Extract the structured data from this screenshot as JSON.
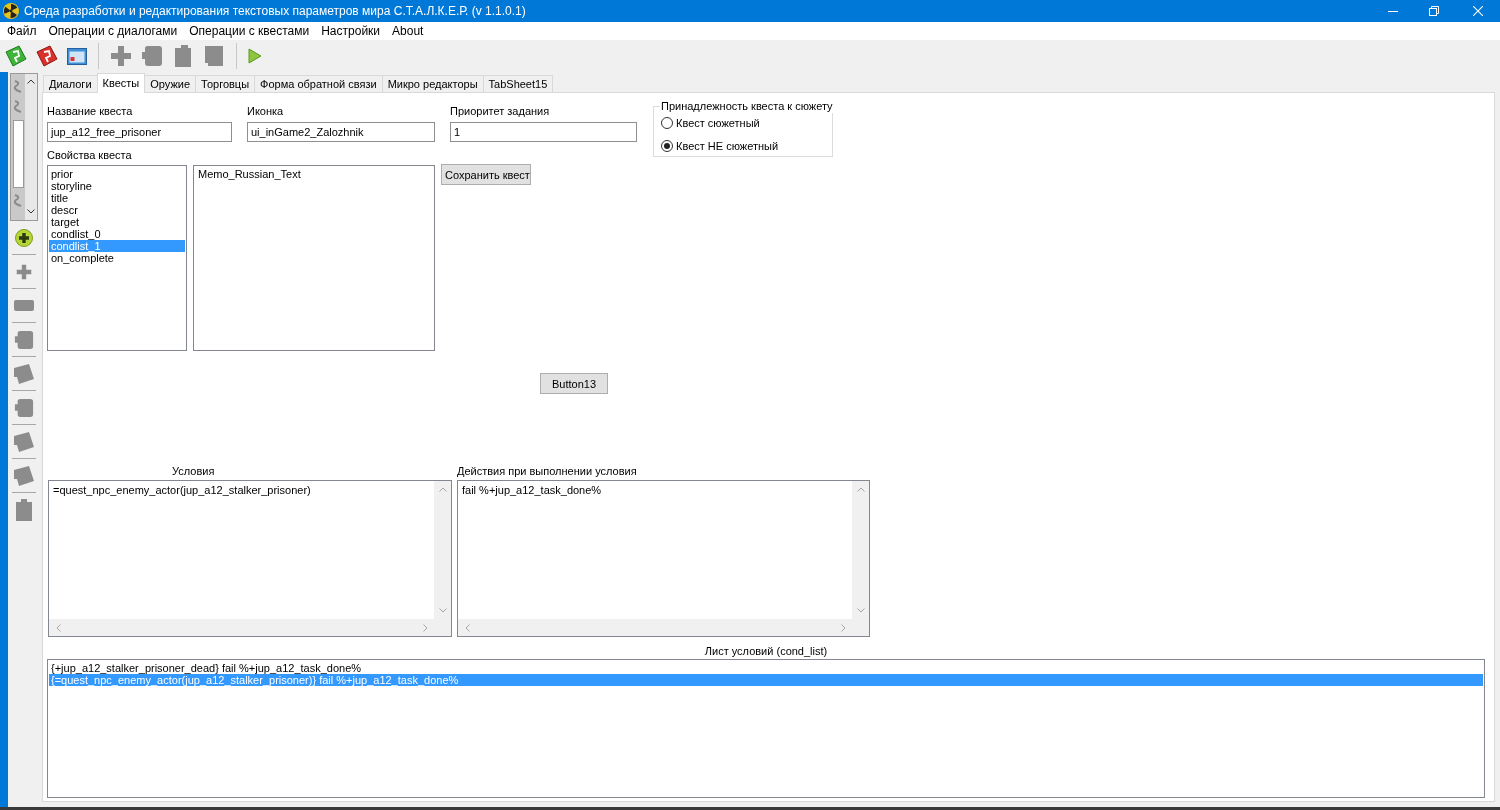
{
  "window": {
    "title": "Среда разработки и редактирования текстовых параметров мира С.Т.А.Л.К.Е.Р. (v 1.1.0.1)"
  },
  "menu": [
    {
      "label": "Файл"
    },
    {
      "label": "Операции с диалогами"
    },
    {
      "label": "Операции с квестами"
    },
    {
      "label": "Настройки"
    },
    {
      "label": "About"
    }
  ],
  "tabs": [
    {
      "label": "Диалоги",
      "selected": false
    },
    {
      "label": "Квесты",
      "selected": true
    },
    {
      "label": "Оружие",
      "selected": false
    },
    {
      "label": "Торговцы",
      "selected": false
    },
    {
      "label": "Форма обратной связи",
      "selected": false
    },
    {
      "label": "Микро редакторы",
      "selected": false
    },
    {
      "label": "TabSheet15",
      "selected": false
    }
  ],
  "quest_form": {
    "name_field": {
      "label": "Название квеста",
      "value": "jup_a12_free_prisoner"
    },
    "icon_field": {
      "label": "Иконка",
      "value": "ui_inGame2_Zalozhnik"
    },
    "priority_field": {
      "label": "Приоритет задания",
      "value": "1"
    },
    "storyline_group": {
      "title": "Принадлежность квеста к сюжету",
      "options": [
        {
          "label": "Квест сюжетный",
          "selected": false
        },
        {
          "label": "Квест НЕ сюжетный",
          "selected": true
        }
      ]
    },
    "properties": {
      "label": "Свойства квеста",
      "items": [
        {
          "label": "prior",
          "selected": false
        },
        {
          "label": "storyline",
          "selected": false
        },
        {
          "label": "title",
          "selected": false
        },
        {
          "label": "descr",
          "selected": false
        },
        {
          "label": "target",
          "selected": false
        },
        {
          "label": "condlist_0",
          "selected": false
        },
        {
          "label": "condlist_1",
          "selected": true
        },
        {
          "label": "on_complete",
          "selected": false
        }
      ]
    },
    "memo": {
      "value": "Memo_Russian_Text"
    },
    "save_button": {
      "label": "Сохранить квест"
    },
    "extra_button": {
      "label": "Button13"
    },
    "conditions": {
      "label": "Условия",
      "value": "=quest_npc_enemy_actor(jup_a12_stalker_prisoner)"
    },
    "actions": {
      "label": "Действия при выполнении условия",
      "value": "fail %+jup_a12_task_done%"
    },
    "cond_list": {
      "label": "Лист условий (cond_list)",
      "items": [
        {
          "label": "{+jup_a12_stalker_prisoner_dead} fail %+jup_a12_task_done%",
          "selected": false
        },
        {
          "label": "{=quest_npc_enemy_actor(jup_a12_stalker_prisoner)} fail %+jup_a12_task_done%",
          "selected": true
        }
      ]
    }
  }
}
